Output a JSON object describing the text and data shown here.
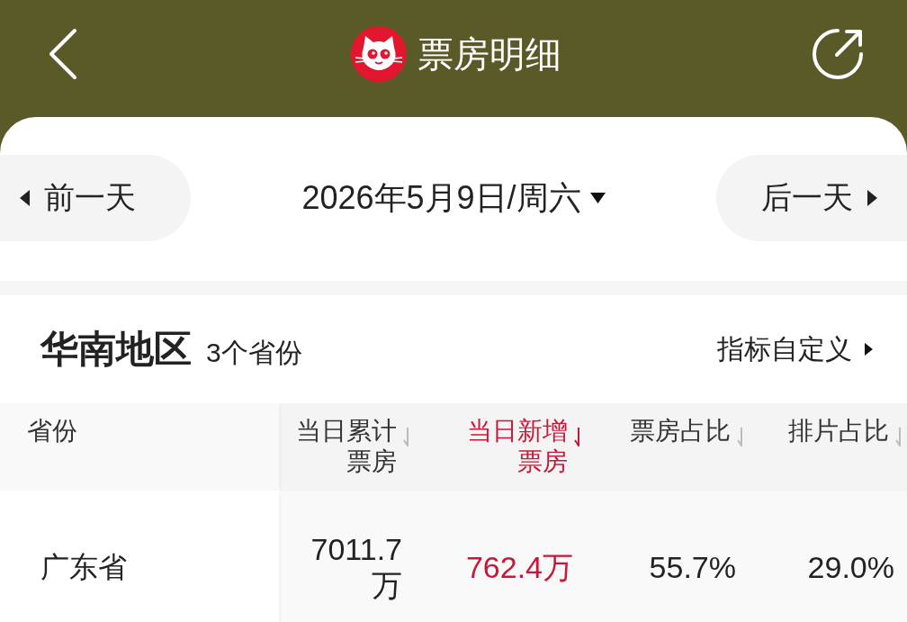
{
  "header": {
    "title": "票房明细"
  },
  "date_nav": {
    "prev_label": "前一天",
    "date": "2026年5月9日/周六",
    "next_label": "后一天"
  },
  "region": {
    "name": "华南地区",
    "count": "3个省份",
    "customize_label": "指标自定义"
  },
  "table": {
    "columns": [
      {
        "label": "省份",
        "kind": "name",
        "sorted": false
      },
      {
        "label": "当日累计票房",
        "kind": "metric",
        "sorted": false
      },
      {
        "label": "当日新增票房",
        "kind": "metric",
        "sorted": true
      },
      {
        "label": "票房占比",
        "kind": "metric",
        "sorted": false
      },
      {
        "label": "排片占比",
        "kind": "metric",
        "sorted": false
      }
    ],
    "rows": [
      {
        "cells": [
          "广东省",
          "7011.7万",
          "762.4万",
          "55.7%",
          "29.0%"
        ]
      }
    ]
  }
}
